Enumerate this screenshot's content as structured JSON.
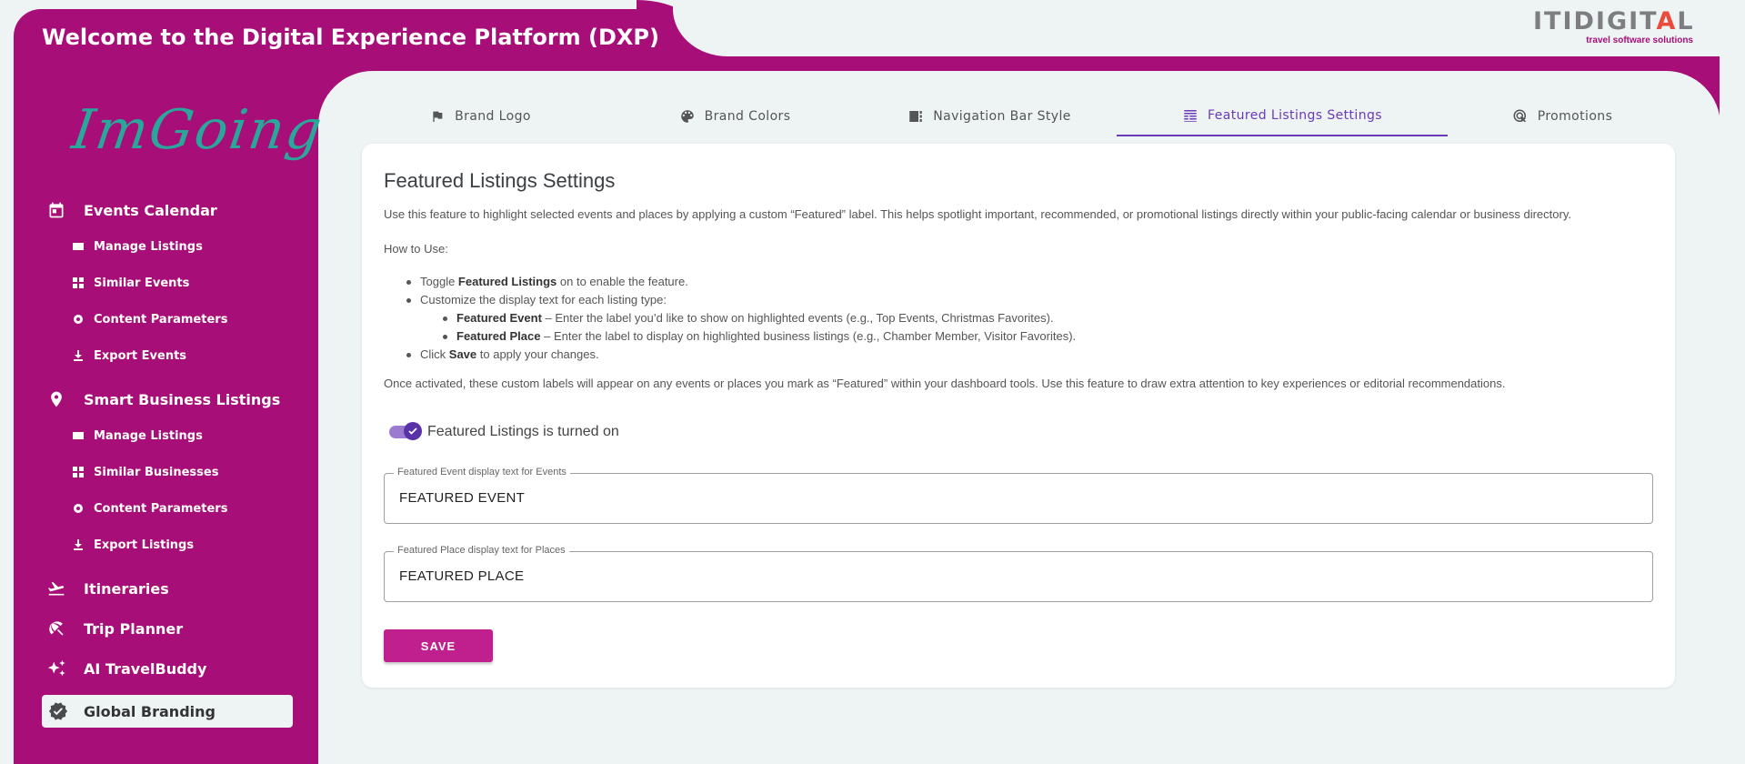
{
  "header": {
    "title": "Welcome to the Digital Experience Platform (DXP)",
    "brand_word_left": "ITIDIGIT",
    "brand_word_tri": "A",
    "brand_word_right": "L",
    "brand_tagline": "travel software solutions"
  },
  "sidebar": {
    "logo_text": "ImGoing",
    "sections": [
      {
        "label": "Events Calendar",
        "icon": "calendar-icon",
        "items": [
          {
            "label": "Manage Listings",
            "icon": "list-icon"
          },
          {
            "label": "Similar Events",
            "icon": "grid-icon"
          },
          {
            "label": "Content Parameters",
            "icon": "gear-icon"
          },
          {
            "label": "Export Events",
            "icon": "download-icon"
          }
        ]
      },
      {
        "label": "Smart Business Listings",
        "icon": "map-pin-icon",
        "items": [
          {
            "label": "Manage Listings",
            "icon": "list-icon"
          },
          {
            "label": "Similar Businesses",
            "icon": "grid-icon"
          },
          {
            "label": "Content Parameters",
            "icon": "gear-icon"
          },
          {
            "label": "Export Listings",
            "icon": "download-icon"
          }
        ]
      },
      {
        "label": "Itineraries",
        "icon": "airplane-icon"
      },
      {
        "label": "Trip Planner",
        "icon": "beach-icon"
      },
      {
        "label": "AI TravelBuddy",
        "icon": "sparkle-icon"
      },
      {
        "label": "Global Branding",
        "icon": "verified-badge-icon",
        "active": true
      }
    ]
  },
  "tabs": [
    {
      "label": "Brand Logo",
      "icon": "flag-icon"
    },
    {
      "label": "Brand Colors",
      "icon": "palette-icon"
    },
    {
      "label": "Navigation Bar Style",
      "icon": "navbar-icon"
    },
    {
      "label": "Featured Listings Settings",
      "icon": "featured-list-icon",
      "active": true
    },
    {
      "label": "Promotions",
      "icon": "promo-icon"
    }
  ],
  "content": {
    "heading": "Featured Listings Settings",
    "description": "Use this feature to highlight selected events and places by applying a custom “Featured” label. This helps spotlight important, recommended, or promotional listings directly within your public-facing calendar or business directory.",
    "howto_label": "How to Use:",
    "steps": {
      "toggle_pre": "Toggle ",
      "toggle_bold": "Featured Listings",
      "toggle_post": " on to enable the feature.",
      "customize": "Customize the display text for each listing type:",
      "event_bold": "Featured Event",
      "event_text": " – Enter the label you’d like to show on highlighted events (e.g., Top Events, Christmas Favorites).",
      "place_bold": "Featured Place",
      "place_text": " – Enter the label to display on highlighted business listings (e.g., Chamber Member, Visitor Favorites).",
      "click_pre": "Click ",
      "click_bold": "Save",
      "click_post": " to apply your changes."
    },
    "after_text": "Once activated, these custom labels will appear on any events or places you mark as “Featured” within your dashboard tools. Use this feature to draw extra attention to key experiences or editorial recommendations.",
    "toggle_label": "Featured Listings is turned on",
    "toggle_on": true,
    "event_field": {
      "legend": "Featured Event display text for Events",
      "value": "FEATURED EVENT"
    },
    "place_field": {
      "legend": "Featured Place display text for Places",
      "value": "FEATURED PLACE"
    },
    "save_label": "SAVE"
  },
  "colors": {
    "brand": "#a70e78",
    "accent": "#6a3ab8",
    "save": "#c0208e",
    "logo": "#2aa79b"
  }
}
